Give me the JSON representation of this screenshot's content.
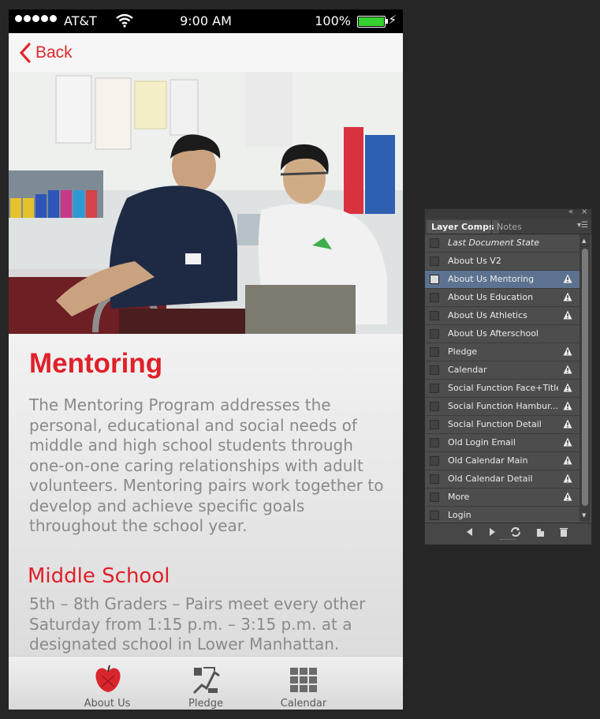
{
  "status_bar": {
    "carrier": "AT&T",
    "time": "9:00 AM",
    "battery": "100%"
  },
  "nav": {
    "back_label": "Back"
  },
  "content": {
    "title": "Mentoring",
    "body": "The Mentoring Program addresses the personal, educational and social needs of middle and high school students through one-on-one caring relationships with adult volunteers. Mentoring pairs work together to develop and achieve specific goals throughout the school year.",
    "subtitle": "Middle School",
    "detail": "5th – 8th Graders – Pairs meet every other Saturday from 1:15 p.m. – 3:15 p.m. at a designated school in Lower Manhattan."
  },
  "tab_bar": {
    "tabs": [
      {
        "label": "About Us",
        "icon": "apple-icon"
      },
      {
        "label": "Pledge",
        "icon": "pledge-icon"
      },
      {
        "label": "Calendar",
        "icon": "calendar-grid-icon"
      }
    ]
  },
  "panel": {
    "tabs": {
      "active": "Layer Comps",
      "inactive": "Notes"
    },
    "items": [
      {
        "label": "Last Document State",
        "italic": true,
        "warning": false,
        "selected": false
      },
      {
        "label": "About Us V2",
        "warning": false,
        "selected": false
      },
      {
        "label": "About Us Mentoring",
        "warning": true,
        "selected": true
      },
      {
        "label": "About Us Education",
        "warning": true,
        "selected": false
      },
      {
        "label": "About Us Athletics",
        "warning": true,
        "selected": false
      },
      {
        "label": "About Us Afterschool",
        "warning": false,
        "selected": false
      },
      {
        "label": "Pledge",
        "warning": true,
        "selected": false
      },
      {
        "label": "Calendar",
        "warning": true,
        "selected": false
      },
      {
        "label": "Social Function Face+Title",
        "warning": true,
        "selected": false
      },
      {
        "label": "Social Function Hambur...",
        "warning": true,
        "selected": false
      },
      {
        "label": "Social Function Detail",
        "warning": true,
        "selected": false
      },
      {
        "label": "Old Login Email",
        "warning": true,
        "selected": false
      },
      {
        "label": "Old Calendar Main",
        "warning": true,
        "selected": false
      },
      {
        "label": "Old Calendar Detail",
        "warning": true,
        "selected": false
      },
      {
        "label": "More",
        "warning": true,
        "selected": false
      },
      {
        "label": "Login",
        "warning": false,
        "selected": false
      }
    ]
  },
  "colors": {
    "accent": "#e0202a",
    "body_text": "#8a8a8a",
    "panel_selected": "#5c7290",
    "battery": "#35d12f"
  }
}
